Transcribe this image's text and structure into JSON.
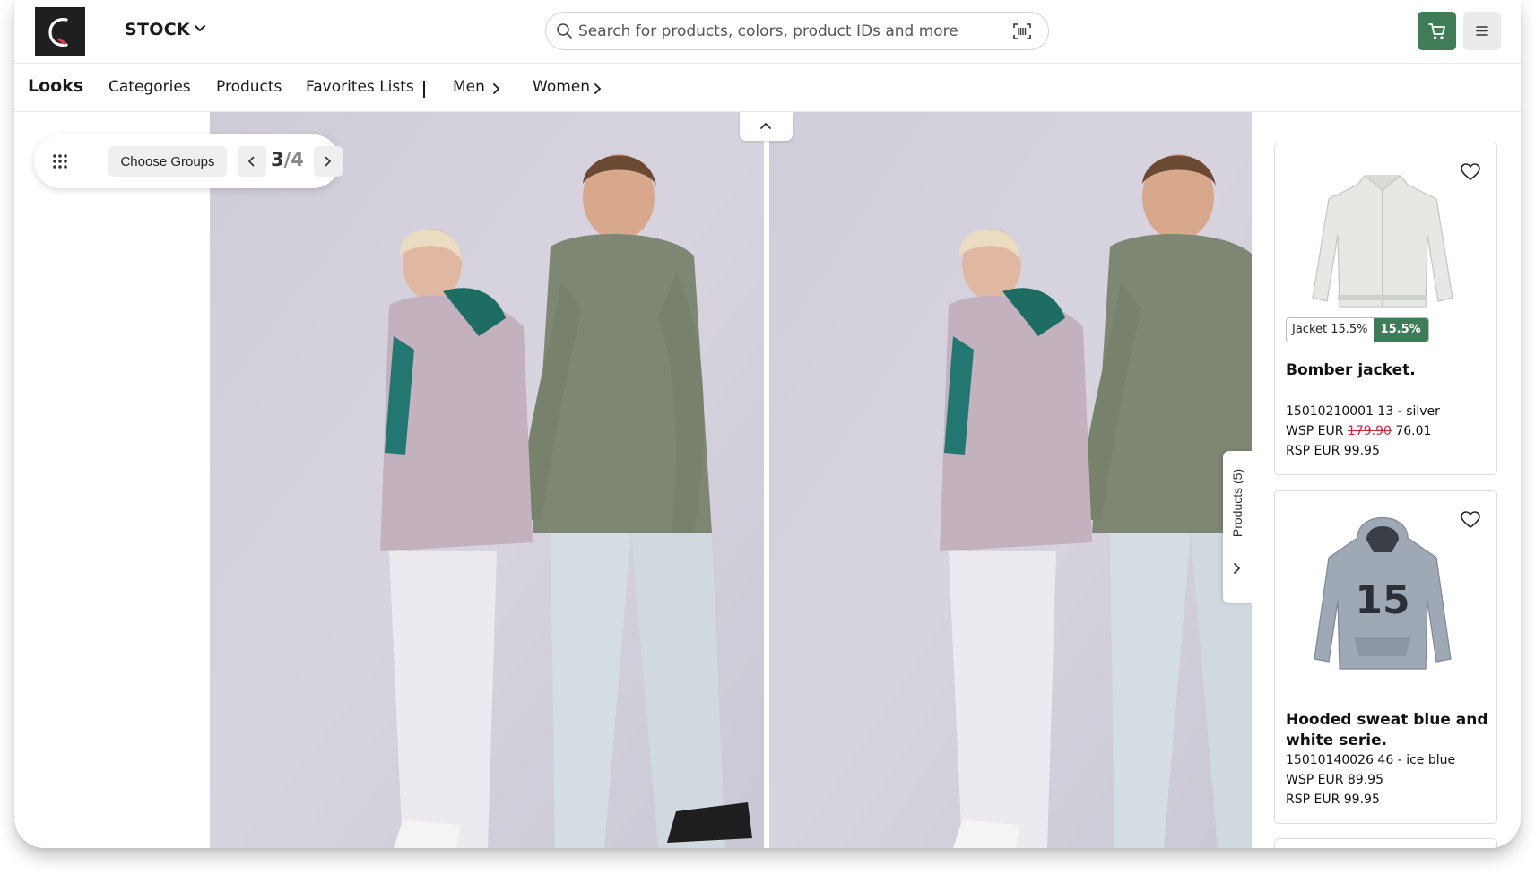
{
  "header": {
    "store_label": "STOCK",
    "search_placeholder": "Search for products, colors, product IDs and more"
  },
  "nav": {
    "items": [
      {
        "label": "Looks",
        "active": true
      },
      {
        "label": "Categories"
      },
      {
        "label": "Products"
      },
      {
        "label": "Favorites Lists"
      },
      {
        "label": "Men",
        "has_submenu": true
      },
      {
        "label": "Women",
        "has_submenu": true
      }
    ]
  },
  "look_controls": {
    "choose_groups_label": "Choose Groups",
    "current_page": "3",
    "separator": "/",
    "total_pages": "4"
  },
  "products_panel": {
    "tab_label": "Products (5)",
    "cards": [
      {
        "badge_label": "Jacket 15.5%",
        "badge_value": "15.5%",
        "name": "Bomber jacket.",
        "id_line": "15010210001 13 - silver",
        "wsp_prefix": "WSP EUR",
        "wsp_old": "179.90",
        "wsp_new": "76.01",
        "rsp": "RSP EUR 99.95"
      },
      {
        "name": "Hooded sweat blue and white serie.",
        "id_line": "15010140026 46 - ice blue",
        "wsp": "WSP EUR 89.95",
        "rsp": "RSP EUR 99.95",
        "print_text": "15"
      }
    ]
  },
  "colors": {
    "accent_green": "#3f7d58",
    "strike_red": "#c8283c",
    "logo_bg": "#1f1f1f",
    "photo_bg": "#cfcfda"
  }
}
